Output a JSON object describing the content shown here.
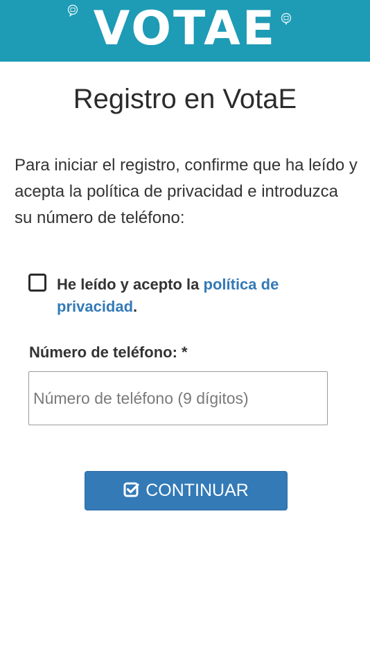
{
  "header": {
    "logo_text": "VOTAE",
    "background_color": "#1e9bb5"
  },
  "page": {
    "title": "Registro en VotaE",
    "intro": "Para iniciar el registro, confirme que ha leído y acepta la política de privacidad e introduzca su número de teléfono:"
  },
  "consent": {
    "checked": false,
    "text_before": "He leído y acepto la ",
    "link_text": "política de privacidad",
    "text_after": ".",
    "link_color": "#337ab7"
  },
  "phone": {
    "label": "Número de teléfono: *",
    "value": "",
    "placeholder": "Número de teléfono (9 dígitos)"
  },
  "actions": {
    "continue_label": "CONTINUAR",
    "continue_icon": "check-square-icon",
    "button_color": "#337ab7"
  }
}
